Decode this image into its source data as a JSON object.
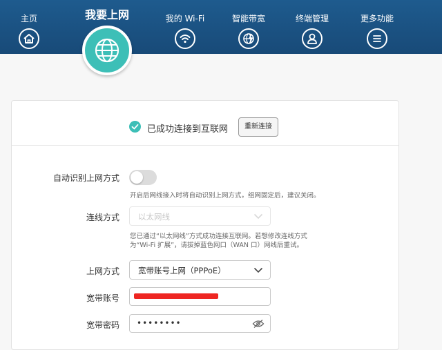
{
  "nav": {
    "items": [
      {
        "label": "主页",
        "icon": "home-icon"
      },
      {
        "label": "我的 Wi-Fi",
        "icon": "wifi-icon"
      },
      {
        "label": "智能带宽",
        "icon": "bandwidth-icon"
      },
      {
        "label": "终端管理",
        "icon": "user-icon"
      },
      {
        "label": "更多功能",
        "icon": "menu-icon"
      }
    ],
    "active": {
      "label": "我要上网",
      "icon": "globe-icon"
    }
  },
  "status": {
    "text": "已成功连接到互联网",
    "reconnect_label": "重新连接",
    "icon": "check-icon"
  },
  "form": {
    "auto_detect": {
      "label": "自动识别上网方式",
      "enabled": false,
      "hint": "开启后网线接入时将自动识别上网方式，组网固定后，建议关闭。"
    },
    "connection_mode": {
      "label": "连线方式",
      "value": "以太网线",
      "hint_line1": "您已通过“以太网线”方式成功连接互联网。若想修改连线方式",
      "hint_line2": "为“Wi-Fi 扩展”，请拔掉蓝色网口（WAN 口）网线后重试。"
    },
    "internet_mode": {
      "label": "上网方式",
      "value": "宽带账号上网（PPPoE）"
    },
    "account": {
      "label": "宽带账号"
    },
    "password": {
      "label": "宽带密码",
      "value": "••••••••",
      "icon": "eye-icon"
    }
  },
  "colors": {
    "header": "#1e5b8e",
    "accent": "#3dbfb7",
    "redaction": "#ee2622"
  }
}
